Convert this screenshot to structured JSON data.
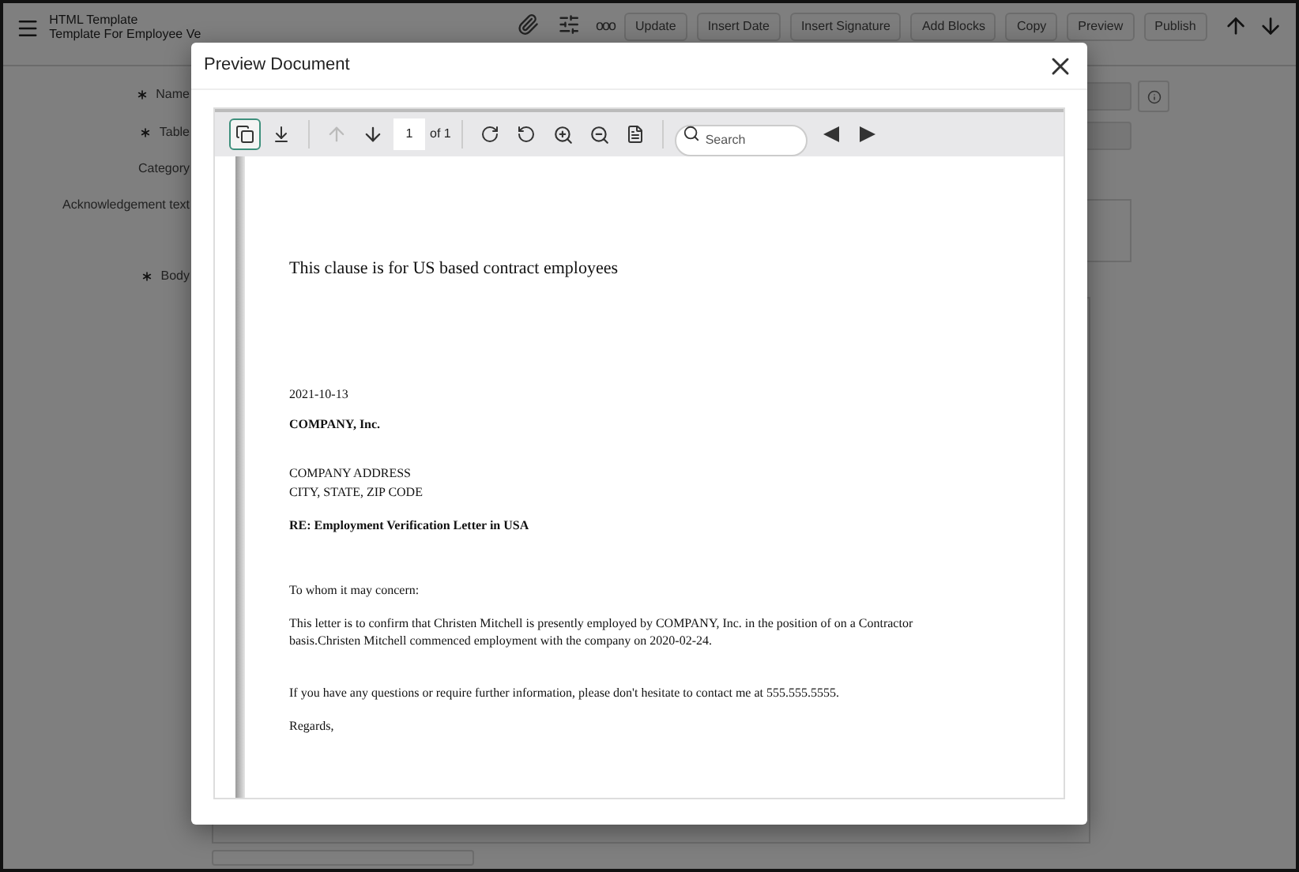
{
  "header": {
    "title": "HTML Template",
    "subtitle": "Template For Employee Ve",
    "more": "ooo",
    "buttons": [
      "Update",
      "Insert Date",
      "Insert Signature",
      "Add Blocks",
      "Copy",
      "Preview",
      "Publish"
    ]
  },
  "form": {
    "fields": [
      {
        "label": "Name",
        "required": true
      },
      {
        "label": "Table",
        "required": true
      },
      {
        "label": "Category",
        "required": false
      },
      {
        "label": "Acknowledgement text",
        "required": false
      },
      {
        "label": "Body",
        "required": true
      }
    ]
  },
  "dialog": {
    "title": "Preview Document",
    "toolbar": {
      "sidebar_toggle": {
        "selected": true
      },
      "previous_page": {
        "disabled": true
      },
      "next_page": {
        "disabled": false
      },
      "page": "1",
      "page_count": "of 1",
      "search": {
        "placeholder": "Search"
      }
    },
    "document": [
      {
        "kind": "heading",
        "text": "This clause is for US based contract employees"
      },
      {
        "kind": "text",
        "text": "2021-10-13"
      },
      {
        "kind": "bold",
        "text": "COMPANY, Inc."
      },
      {
        "kind": "text",
        "text": "COMPANY ADDRESS"
      },
      {
        "kind": "text",
        "text": "CITY, STATE, ZIP CODE"
      },
      {
        "kind": "bold",
        "text": "RE: Employment Verification Letter in USA"
      },
      {
        "kind": "text",
        "text": "To whom it may concern:"
      },
      {
        "kind": "text",
        "text": "This letter is to confirm that Christen Mitchell is presently employed by COMPANY, Inc. in the position of on a Contractor basis.Christen Mitchell commenced employment with the company on 2020-02-24."
      },
      {
        "kind": "text",
        "text": "If you have any questions or require further information, please don't hesitate to contact me at 555.555.5555."
      },
      {
        "kind": "text",
        "text": "Regards,"
      }
    ]
  }
}
